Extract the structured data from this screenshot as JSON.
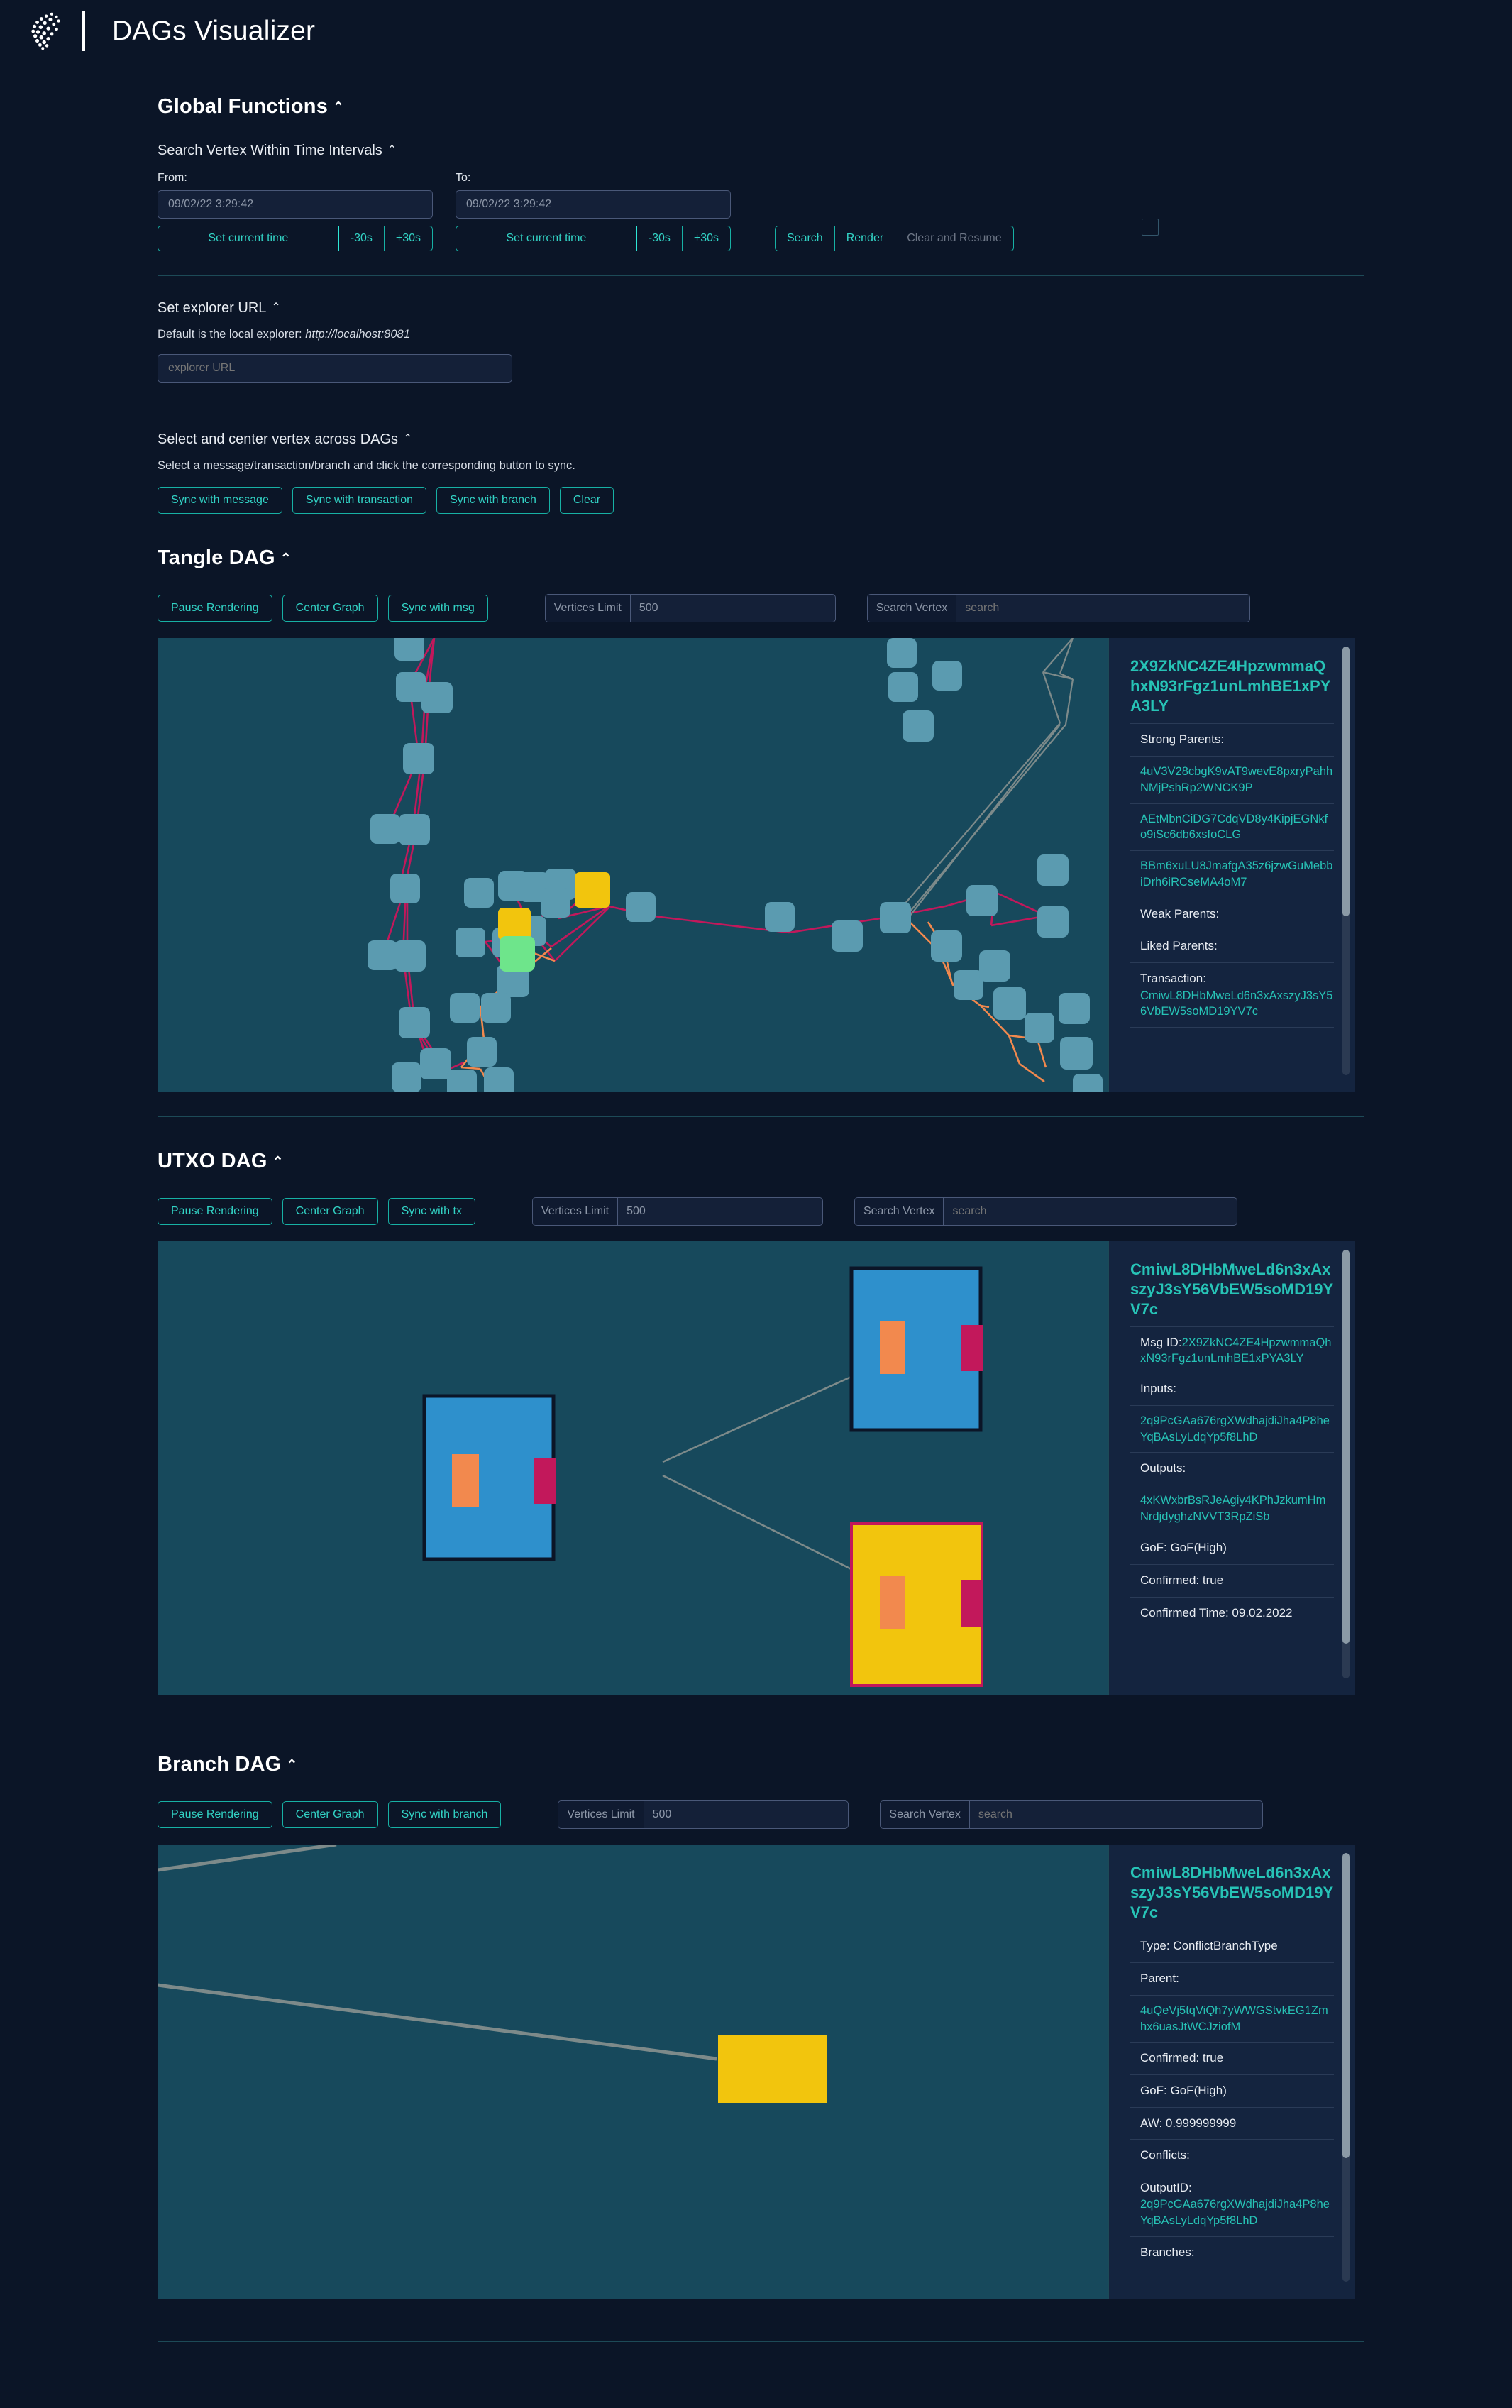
{
  "app": {
    "title": "DAGs Visualizer",
    "logo_icon": "iota-logo-icon"
  },
  "global_functions": {
    "title": "Global Functions",
    "caret": "⌃",
    "search_time": {
      "title": "Search Vertex Within Time Intervals",
      "from_label": "From:",
      "to_label": "To:",
      "from_value": "09/02/22 3:29:42",
      "to_value": "09/02/22 3:29:42",
      "set_current_time": "Set current time",
      "minus30": "-30s",
      "plus30": "+30s",
      "search": "Search",
      "render": "Render",
      "clear_and_resume": "Clear and Resume"
    },
    "explorer_url": {
      "title": "Set explorer URL",
      "hint_prefix": "Default is the local explorer: ",
      "hint_url": "http://localhost:8081",
      "placeholder": "explorer URL"
    },
    "select_center": {
      "title": "Select and center vertex across DAGs",
      "hint": "Select a message/transaction/branch and click the corresponding button to sync.",
      "sync_message": "Sync with message",
      "sync_transaction": "Sync with transaction",
      "sync_branch": "Sync with branch",
      "clear": "Clear"
    }
  },
  "tangle_dag": {
    "title": "Tangle DAG",
    "pause_rendering": "Pause Rendering",
    "center_graph": "Center Graph",
    "sync_label": "Sync with msg",
    "vertices_limit_label": "Vertices Limit",
    "vertices_limit_value": "500",
    "search_vertex_label": "Search Vertex",
    "search_placeholder": "search",
    "panel": {
      "id": "2X9ZkNC4ZE4HpzwmmaQhxN93rFgz1unLmhBE1xPYA3LY",
      "strong_parents_label": "Strong Parents:",
      "strong_parents": [
        "4uV3V28cbgK9vAT9wevE8pxryPahhNMjPshRp2WNCK9P",
        "AEtMbnCiDG7CdqVD8y4KipjEGNkfo9iSc6db6xsfoCLG",
        "BBm6xuLU8JmafgA35z6jzwGuMebbiDrh6iRCseMA4oM7"
      ],
      "weak_parents_label": "Weak Parents:",
      "liked_parents_label": "Liked Parents:",
      "transaction_label": "Transaction:",
      "transaction_value": "CmiwL8DHbMweLd6n3xAxszyJ3sY56VbEW5soMD19YV7c"
    }
  },
  "utxo_dag": {
    "title": "UTXO DAG",
    "pause_rendering": "Pause Rendering",
    "center_graph": "Center Graph",
    "sync_label": "Sync with tx",
    "vertices_limit_label": "Vertices Limit",
    "vertices_limit_value": "500",
    "search_vertex_label": "Search Vertex",
    "search_placeholder": "search",
    "panel": {
      "id": "CmiwL8DHbMweLd6n3xAxszyJ3sY56VbEW5soMD19YV7c",
      "msg_id_label": "Msg ID:",
      "msg_id_value": "2X9ZkNC4ZE4HpzwmmaQhxN93rFgz1unLmhBE1xPYA3LY",
      "inputs_label": "Inputs:",
      "inputs": [
        "2q9PcGAa676rgXWdhajdiJha4P8heYqBAsLyLdqYp5f8LhD"
      ],
      "outputs_label": "Outputs:",
      "outputs": [
        "4xKWxbrBsRJeAgiy4KPhJzkumHmNrdjdyghzNVVT3RpZiSb"
      ],
      "gof": "GoF: GoF(High)",
      "confirmed": "Confirmed: true",
      "confirmed_time": "Confirmed Time: 09.02.2022"
    }
  },
  "branch_dag": {
    "title": "Branch DAG",
    "pause_rendering": "Pause Rendering",
    "center_graph": "Center Graph",
    "sync_label": "Sync with branch",
    "vertices_limit_label": "Vertices Limit",
    "vertices_limit_value": "500",
    "search_vertex_label": "Search Vertex",
    "search_placeholder": "search",
    "panel": {
      "id": "CmiwL8DHbMweLd6n3xAxszyJ3sY56VbEW5soMD19YV7c",
      "type": "Type: ConflictBranchType",
      "parent_label": "Parent:",
      "parents": [
        "4uQeVj5tqViQh7yWWGStvkEG1Zmhx6uasJtWCJziofM"
      ],
      "confirmed": "Confirmed: true",
      "gof": "GoF: GoF(High)",
      "aw": "AW: 0.999999999",
      "conflicts_label": "Conflicts:",
      "output_id_label": "OutputID:",
      "output_id_value": "2q9PcGAa676rgXWdhajdiJha4P8heYqBAsLyLdqYp5f8LhD",
      "branches_label": "Branches:"
    }
  },
  "colors": {
    "page_bg": "#0b1527",
    "graph_bg": "#17495c",
    "accent": "#27c3b6",
    "node_teal": "#5b9bb0",
    "node_yellow": "#f2c50d",
    "node_green": "#6ee58b",
    "edge_pink": "#c2185b",
    "edge_orange": "#f2894e",
    "edge_gray": "#7d8a8a",
    "utxo_blue": "#2e90cc",
    "utxo_yellow": "#f2c50d",
    "utxo_input": "#f2894e",
    "utxo_output": "#c2185b",
    "panel_bg": "#14243f"
  }
}
